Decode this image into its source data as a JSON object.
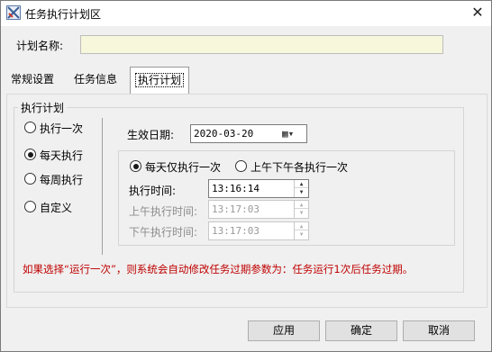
{
  "window": {
    "title": "任务执行计划区",
    "close_label": "✕"
  },
  "plan_name": {
    "label": "计划名称:",
    "value": ""
  },
  "tabs": [
    {
      "label": "常规设置",
      "active": false
    },
    {
      "label": "任务信息",
      "active": false
    },
    {
      "label": "执行计划",
      "active": true
    }
  ],
  "execution_plan": {
    "group_title": "执行计划",
    "options": [
      {
        "label": "执行一次",
        "checked": false
      },
      {
        "label": "每天执行",
        "checked": true
      },
      {
        "label": "每周执行",
        "checked": false
      },
      {
        "label": "自定义",
        "checked": false
      }
    ],
    "effective_date": {
      "label": "生效日期:",
      "value": "2020-03-20"
    },
    "daily_mode": {
      "once": {
        "label": "每天仅执行一次",
        "checked": true
      },
      "am_pm": {
        "label": "上午下午各执行一次",
        "checked": false
      }
    },
    "exec_time": {
      "label": "执行时间:",
      "value": "13:16:14"
    },
    "am_time": {
      "label": "上午执行时间:",
      "value": "13:17:03"
    },
    "pm_time": {
      "label": "下午执行时间:",
      "value": "13:17:03"
    },
    "note": "如果选择“运行一次”，则系统会自动修改任务过期参数为：任务运行1次后任务过期。"
  },
  "buttons": {
    "apply": "应用",
    "ok": "确定",
    "cancel": "取消"
  },
  "colors": {
    "note": "#c00000",
    "input_bg": "#f6f7db",
    "window_bg": "#f0f0f0"
  },
  "icons": {
    "app": "app-icon",
    "calendar": "calendar-icon",
    "spin": "spin-arrows-icon"
  }
}
